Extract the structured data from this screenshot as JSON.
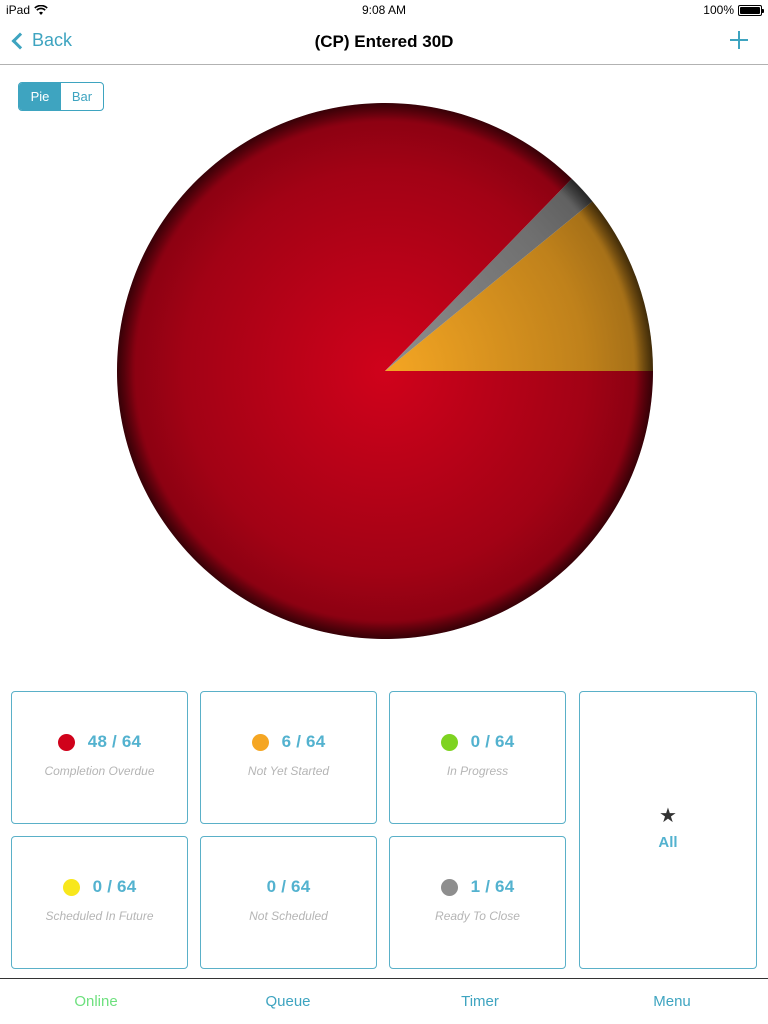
{
  "status_bar": {
    "device": "iPad",
    "wifi_icon": "wifi-icon",
    "time": "9:08 AM",
    "battery_percent": "100%",
    "battery_level": 1.0
  },
  "nav": {
    "back_label": "Back",
    "title": "(CP) Entered 30D",
    "add_icon": "plus-icon"
  },
  "chart_toggle": {
    "options": [
      "Pie",
      "Bar"
    ],
    "selected": "Pie"
  },
  "tiles": [
    {
      "key": "completion_overdue",
      "count": "48 / 64",
      "label": "Completion Overdue",
      "color": "#d0021b"
    },
    {
      "key": "not_yet_started",
      "count": "6 / 64",
      "label": "Not Yet Started",
      "color": "#f5a623"
    },
    {
      "key": "in_progress",
      "count": "0 / 64",
      "label": "In Progress",
      "color": "#7ed321"
    },
    {
      "key": "scheduled_in_future",
      "count": "0 / 64",
      "label": "Scheduled In Future",
      "color": "#f8e71c"
    },
    {
      "key": "not_scheduled",
      "count": "0 / 64",
      "label": "Not Scheduled",
      "color": null
    },
    {
      "key": "ready_to_close",
      "count": "1 / 64",
      "label": "Ready To Close",
      "color": "#8e8e8e"
    }
  ],
  "all_tile": {
    "icon": "star-icon",
    "label": "All"
  },
  "tab_bar": {
    "tabs": [
      {
        "label": "Online",
        "color": "#6ee07e"
      },
      {
        "label": "Queue"
      },
      {
        "label": "Timer"
      },
      {
        "label": "Menu"
      }
    ]
  },
  "chart_data": {
    "type": "pie",
    "title": "",
    "total": 64,
    "slices": [
      {
        "name": "Not Yet Started",
        "value": 6,
        "color": "#f5a623"
      },
      {
        "name": "Ready To Close",
        "value": 1,
        "color": "#8e8e8e"
      },
      {
        "name": "Completion Overdue",
        "value": 48,
        "color": "#d0021b"
      }
    ],
    "start_direction": "east",
    "sweep": "counter-clockwise",
    "legend": "none",
    "shading": "radial"
  }
}
